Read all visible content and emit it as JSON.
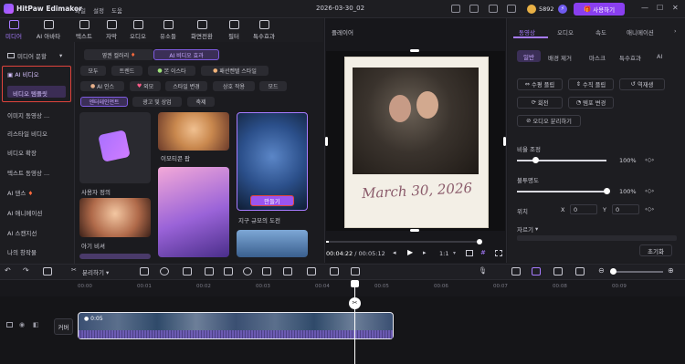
{
  "app": {
    "name": "HitPaw Edimakor",
    "project": "2026-03-30_02",
    "coins": "5892",
    "buy": "사용하기"
  },
  "menu": [
    "파일",
    "설정",
    "도움"
  ],
  "toolbar": [
    {
      "label": "미디어",
      "icon": "folder-icon",
      "active": true
    },
    {
      "label": "AI 아바타",
      "icon": "avatar-icon"
    },
    {
      "label": "텍스트",
      "icon": "text-icon"
    },
    {
      "label": "자막",
      "icon": "subtitle-icon"
    },
    {
      "label": "오디오",
      "icon": "audio-icon"
    },
    {
      "label": "유소들",
      "icon": "sticker-icon"
    },
    {
      "label": "화면전환",
      "icon": "transition-icon"
    },
    {
      "label": "필터",
      "icon": "filter-icon"
    },
    {
      "label": "특수효과",
      "icon": "effects-icon"
    }
  ],
  "leftnav": {
    "header": "미디어 문할",
    "items": [
      "AI 비디오",
      "비디오 템플릿",
      "이미지 동영상 ...",
      "리스타일 비디오",
      "비디오 확장",
      "텍스트 동영상 ...",
      "AI 댄스",
      "AI 애니메이션",
      "AI 스캔지선",
      "나의 창작물"
    ]
  },
  "tabs": {
    "first": "영권 컬러리",
    "second": "AI 비디오 효과"
  },
  "chips_row1": [
    "모두",
    "트렌드",
    "본 이스타",
    "패션켄텔 스타일"
  ],
  "chips_row2": [
    "AI 인스",
    "외모",
    "스타일 변경",
    "상호 작용",
    "모드"
  ],
  "chips_row3": [
    "엔터테인먼트",
    "광고 및 상업",
    "축제"
  ],
  "cards": [
    {
      "label": "사용자 정의",
      "icon": "custom-image-icon"
    },
    {
      "label": "이모티콘 팝"
    },
    {
      "label": "지구 규모의 도전",
      "button": "만들기"
    },
    {
      "label": "아기 비셔"
    }
  ],
  "player": {
    "title": "플레이어",
    "current": "00:04:22",
    "total": "00:05:12",
    "ratio": "1:1",
    "caption": "March 30, 2026",
    "progress": 0.02
  },
  "props": {
    "tabs": [
      "동영상",
      "오디오",
      "속도",
      "애니메이션"
    ],
    "subtabs": [
      "일반",
      "배경 제거",
      "마스크",
      "특수효과",
      "AI"
    ],
    "buttons_row1": [
      "수평 플립",
      "수직 플립",
      "역재생"
    ],
    "buttons_row2": [
      "회전",
      "템포 변경"
    ],
    "button_detach": "오디오 분리하기",
    "scale_label": "비율 조정",
    "scale_value": "100%",
    "scale_level": 0.2,
    "opacity_label": "불투명도",
    "opacity_value": "100%",
    "opacity_level": 1.0,
    "position_label": "위치",
    "x_label": "X",
    "x_value": "0",
    "y_label": "Y",
    "y_value": "0",
    "crop_label": "자르기",
    "reset": "초기화"
  },
  "timeline": {
    "ticks": [
      "00:00",
      "00:01",
      "00:02",
      "00:03",
      "00:04",
      "00:05",
      "00:06",
      "00:07",
      "00:08",
      "00:09"
    ],
    "clip_time": "0:05",
    "cover": "커버"
  }
}
